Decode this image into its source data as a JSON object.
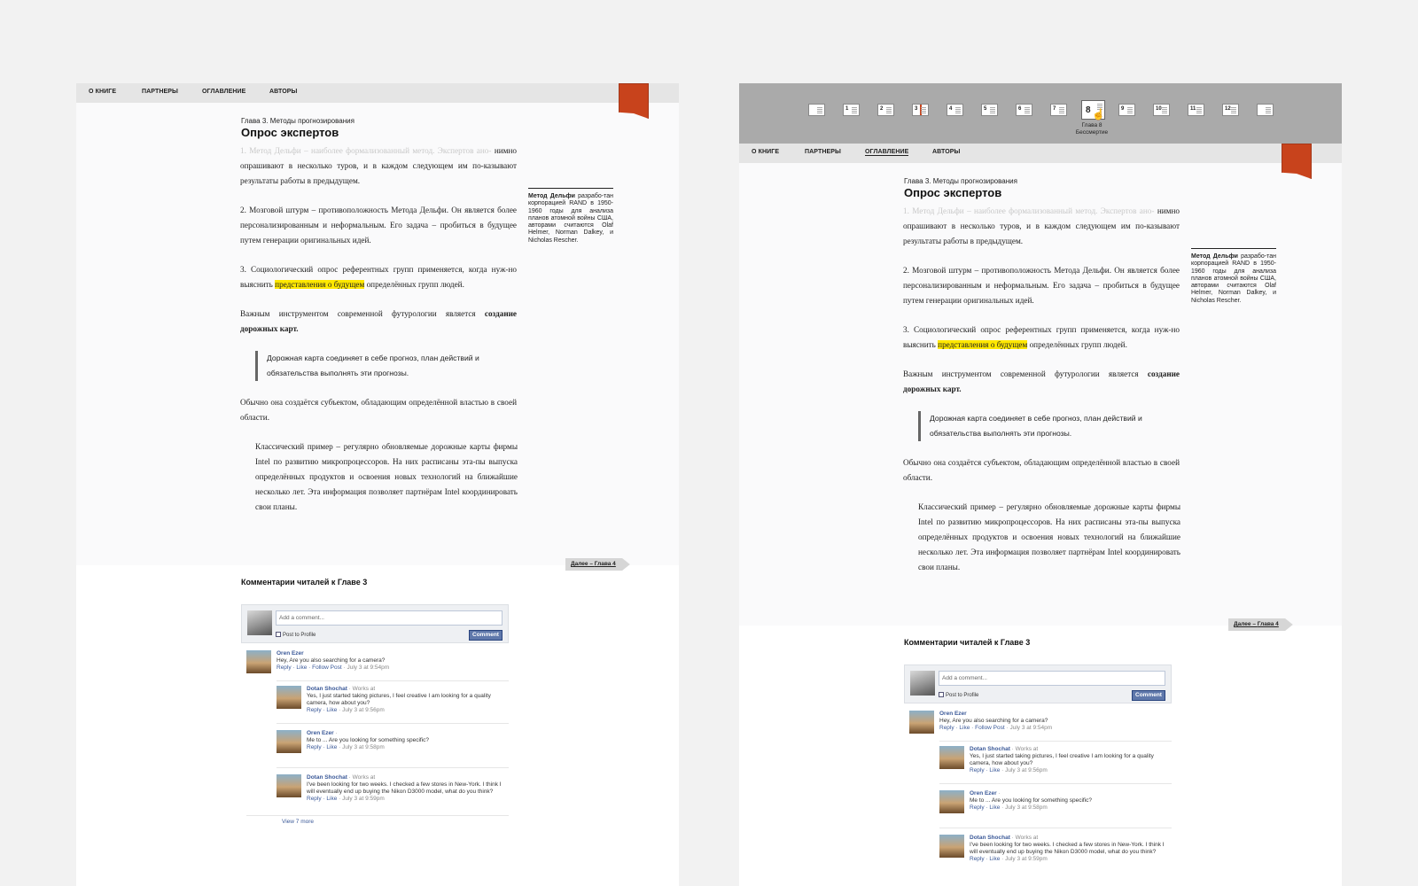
{
  "nav": {
    "items": [
      "О КНИГЕ",
      "ПАРТНЕРЫ",
      "ОГЛАВЛЕНИЕ",
      "АВТОРЫ"
    ]
  },
  "article": {
    "chapter_label": "Глава 3. Методы прогнозирования",
    "title": "Опрос экспертов",
    "p1_faded": "1. Метод Дельфи – наиболее формализованный метод. Экспертов ано-",
    "p1_rest": "нимно опрашивают в несколько туров, и в каждом следующем им по-казывают результаты работы в предыдущем.",
    "p2": "2. Мозговой штурм – противоположность Метода Дельфи. Он является более персонализированным и неформальным. Его задача – пробиться в будущее путем генерации оригинальных идей.",
    "p3_before": "3. Социологический опрос референтных групп применяется, когда нуж-но выяснить ",
    "p3_highlight": "представления о будущем",
    "p3_after": " определённых групп людей.",
    "p4_before": "Важным инструментом современной футурологии является ",
    "p4_bold": "создание дорожных карт.",
    "quote": "Дорожная карта соединяет в себе прогноз, план действий и обязательства выполнять эти прогнозы.",
    "p5": "Обычно она создаётся субъектом, обладающим определённой властью в своей области.",
    "example": "Классический пример – регулярно обновляемые дорожные карты фирмы Intel по развитию микропроцессоров. На них расписаны эта-пы выпуска определённых продуктов и освоения новых технологий на ближайшие несколько лет. Эта информация позволяет партнёрам Intel координировать свои планы.",
    "aside_bold": "Метод Дельфи",
    "aside_text": " разрабо-тан корпорацией RAND в 1950-1960 годы для анализа планов атомной войны США, авторами считаются Olaf Helmer, Norman Dalkey, и Nicholas Rescher.",
    "next_prefix": "Далее – ",
    "next_link": "Глава 4"
  },
  "comments": {
    "title": "Комментарии читалей к Главе 3",
    "placeholder": "Add a comment...",
    "post_to_profile": "Post to Profile",
    "button": "Comment",
    "items": [
      {
        "name": "Oren Ezer",
        "meta": "",
        "text": "Hey, Are you also searching for a camera?",
        "actions": "Reply · Like · Follow Post",
        "date": " · July 3 at 9:54pm"
      },
      {
        "name": "Dotan Shochat",
        "meta": " · Works at",
        "text": "Yes, I just started taking pictures, I feel creative I am looking for a quality camera, how about you?",
        "actions": "Reply · Like",
        "date": " · July 3 at 9:56pm"
      },
      {
        "name": "Oren Ezer",
        "meta": " ·",
        "text": "Me to ... Are you looking for something specific?",
        "actions": "Reply · Like",
        "date": " · July 3 at 9:58pm"
      },
      {
        "name": "Dotan Shochat",
        "meta": " · Works at",
        "text": "I've been looking for two weeks. I checked a few stores in New-York. I think I will eventually end up buying the Nikon D3000 model, what do you think?",
        "actions": "Reply · Like",
        "date": " · July 3 at 9:59pm"
      }
    ],
    "view_more": "View 7 more"
  },
  "thumbs": {
    "numbers": [
      "",
      "1",
      "2",
      "3",
      "4",
      "5",
      "6",
      "7",
      "8",
      "9",
      "10",
      "11",
      "12",
      ""
    ],
    "active_caption_1": "Глава 8",
    "active_caption_2": "Бессмертие"
  },
  "colors": {
    "bookmark": "#c8431c",
    "highlight": "#ffe800",
    "fb_blue": "#3b5998"
  }
}
